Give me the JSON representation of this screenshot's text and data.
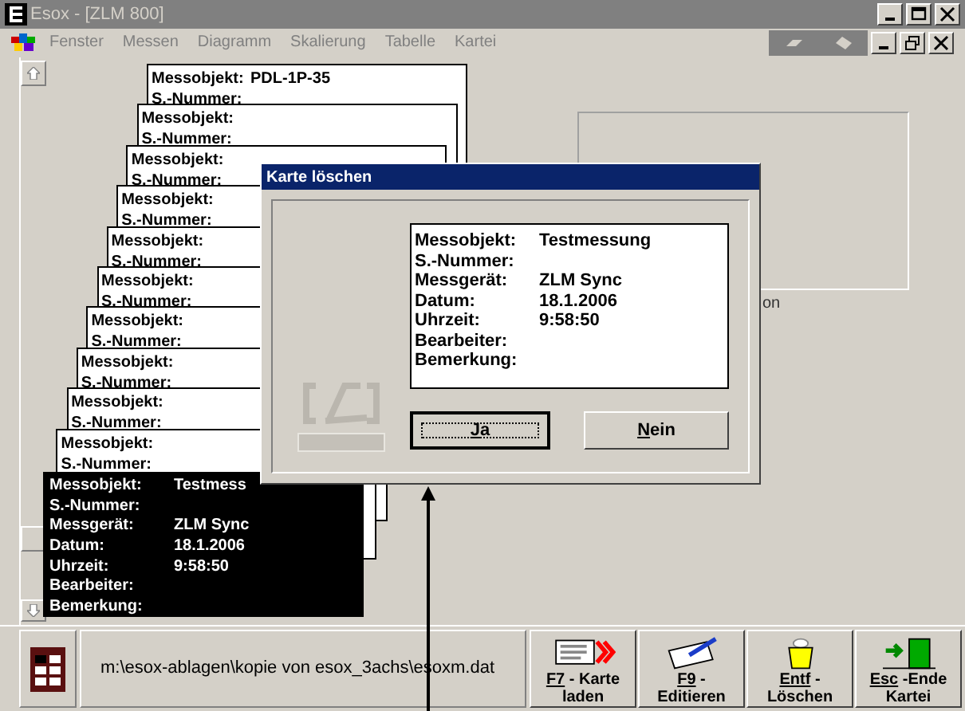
{
  "window": {
    "title": "Esox - [ZLM 800]"
  },
  "menu": [
    {
      "label": "Fenster",
      "disabled": true
    },
    {
      "label": "Messen",
      "disabled": true
    },
    {
      "label": "Diagramm",
      "disabled": true
    },
    {
      "label": "Skalierung",
      "disabled": true
    },
    {
      "label": "Tabelle",
      "disabled": true
    },
    {
      "label": "Kartei",
      "disabled": true
    }
  ],
  "cards": [
    {
      "fields": [
        {
          "label": "Messobjekt:",
          "value": "PDL-1P-35"
        },
        {
          "label": "S.-Nummer:"
        }
      ]
    },
    {
      "fields": [
        {
          "label": "Messobjekt:"
        },
        {
          "label": "S.-Nummer:"
        }
      ]
    },
    {
      "fields": [
        {
          "label": "Messobjekt:"
        },
        {
          "label": "S.-Nummer:"
        }
      ]
    },
    {
      "fields": [
        {
          "label": "Messobjekt:"
        },
        {
          "label": "S.-Nummer:"
        }
      ]
    },
    {
      "fields": [
        {
          "label": "Messobjekt:"
        },
        {
          "label": "S.-Nummer:"
        }
      ]
    },
    {
      "fields": [
        {
          "label": "Messobjekt:"
        },
        {
          "label": "S.-Nummer:"
        }
      ]
    },
    {
      "fields": [
        {
          "label": "Messobjekt:"
        },
        {
          "label": "S.-Nummer:"
        }
      ]
    },
    {
      "fields": [
        {
          "label": "Messobjekt:"
        },
        {
          "label": "S.-Nummer:"
        }
      ]
    },
    {
      "fields": [
        {
          "label": "Messobjekt:"
        },
        {
          "label": "S.-Nummer:"
        }
      ]
    },
    {
      "fields": [
        {
          "label": "Messobjekt:"
        },
        {
          "label": "S.-Nummer:"
        }
      ]
    }
  ],
  "active_card": {
    "fields": [
      {
        "label": "Messobjekt:",
        "value": "Testmess"
      },
      {
        "label": "S.-Nummer:"
      },
      {
        "label": "Messgerät:",
        "value": "ZLM Sync"
      },
      {
        "label": "Datum:",
        "value": "18.1.2006"
      },
      {
        "label": "Uhrzeit:",
        "value": "9:58:50"
      },
      {
        "label": "Bearbeiter:"
      },
      {
        "label": "Bemerkung:"
      }
    ]
  },
  "panel_label": "on",
  "dialog": {
    "title": "Karte löschen",
    "fields": [
      {
        "label": "Messobjekt:",
        "value": "Testmessung"
      },
      {
        "label": "S.-Nummer:"
      },
      {
        "label": "Messgerät:",
        "value": "ZLM Sync"
      },
      {
        "label": "Datum:",
        "value": "18.1.2006"
      },
      {
        "label": "Uhrzeit:",
        "value": "9:58:50"
      },
      {
        "label": "Bearbeiter:"
      },
      {
        "label": "Bemerkung:"
      }
    ],
    "buttons": [
      {
        "label": "Ja",
        "default": true
      },
      {
        "label": "Nein",
        "default": false
      }
    ]
  },
  "status_bar": {
    "path": "m:\\esox-ablagen\\kopie von esox_3achs\\esoxm.dat"
  },
  "function_buttons": [
    {
      "kind": "load",
      "key": "F7",
      "text": "- Karte laden"
    },
    {
      "kind": "edit",
      "key": "F9",
      "text": "- Editieren"
    },
    {
      "kind": "delete",
      "key": "Entf",
      "text": "- Löschen"
    },
    {
      "kind": "exit",
      "key": "Esc",
      "text": "-Ende Kartei"
    }
  ]
}
